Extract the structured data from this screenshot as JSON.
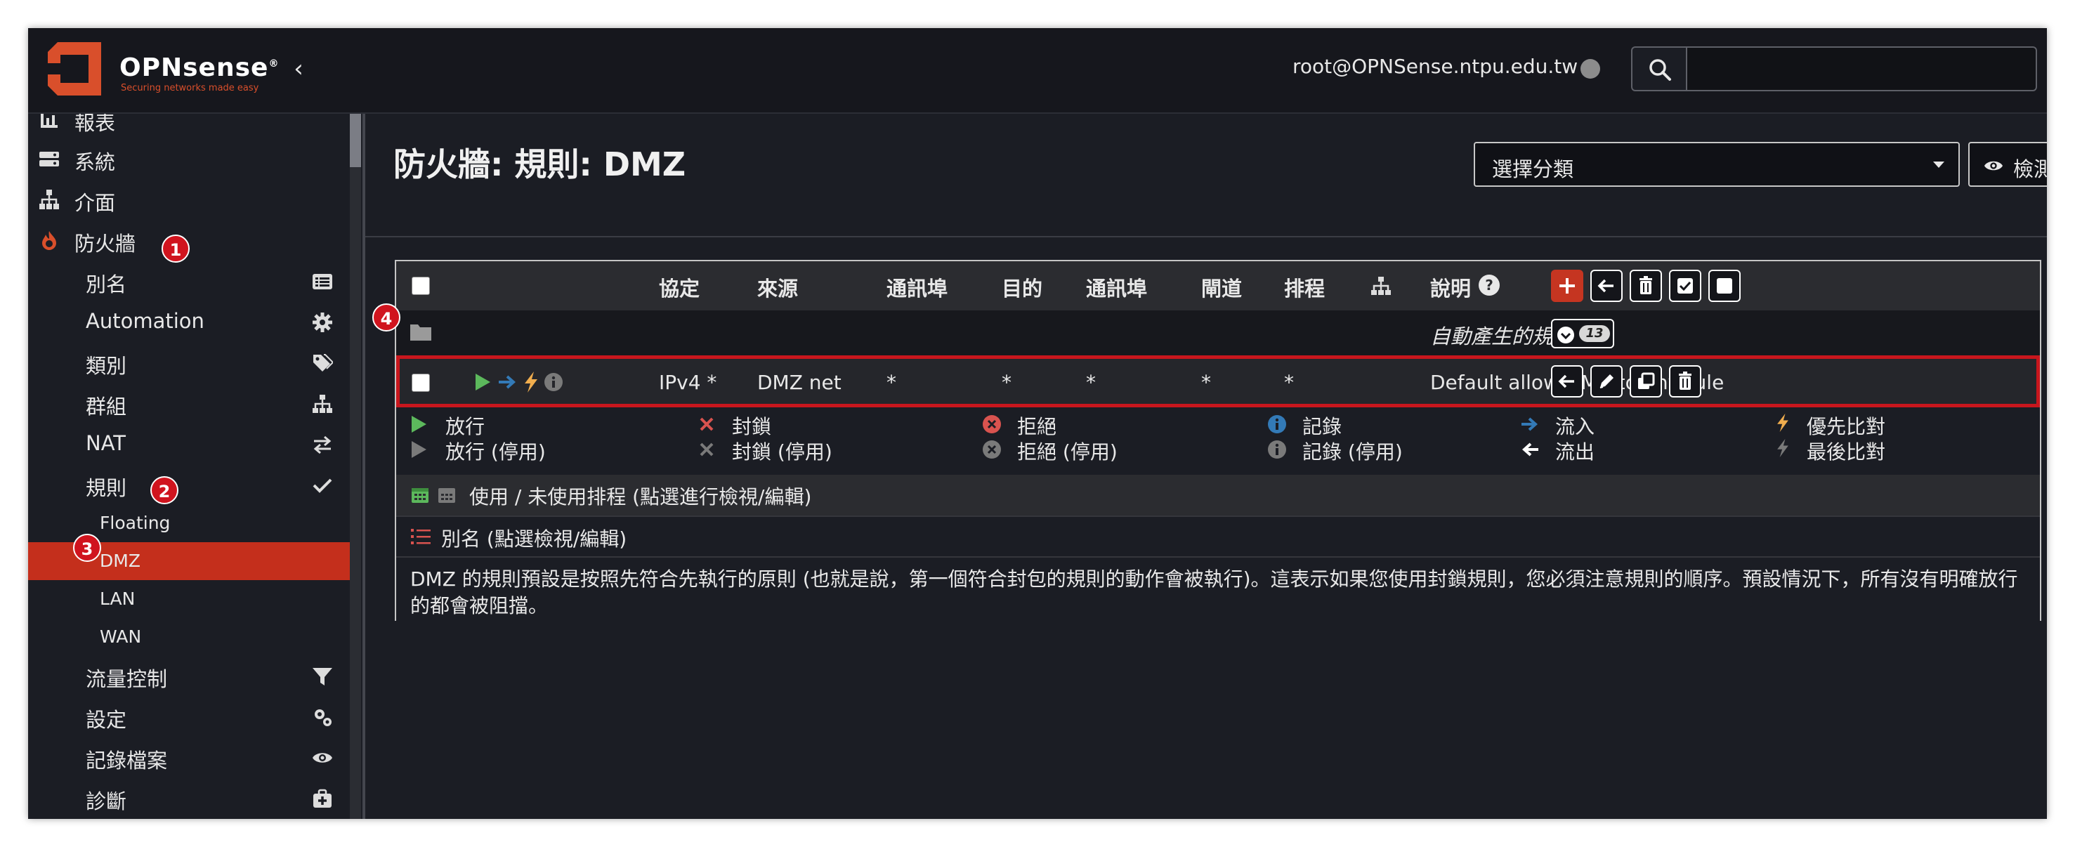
{
  "header": {
    "brand": "OPNsense",
    "brand_mark": "®",
    "tagline": "Securing networks made easy",
    "user": "root@OPNSense.ntpu.edu.tw"
  },
  "sidebar": {
    "items": [
      {
        "label": "報表",
        "icon": "reports-icon"
      },
      {
        "label": "系統",
        "icon": "system-icon"
      },
      {
        "label": "介面",
        "icon": "interfaces-icon"
      },
      {
        "label": "防火牆",
        "icon": "fire-icon"
      },
      {
        "label": "別名",
        "icon": "list-icon"
      },
      {
        "label": "Automation",
        "icon": "gear-icon"
      },
      {
        "label": "類別",
        "icon": "tags-icon"
      },
      {
        "label": "群組",
        "icon": "sitemap-icon"
      },
      {
        "label": "NAT",
        "icon": "exchange-icon"
      },
      {
        "label": "規則",
        "icon": "check-icon"
      },
      {
        "label": "Floating"
      },
      {
        "label": "DMZ"
      },
      {
        "label": "LAN"
      },
      {
        "label": "WAN"
      },
      {
        "label": "流量控制",
        "icon": "filter-icon"
      },
      {
        "label": "設定",
        "icon": "cogs-icon"
      },
      {
        "label": "記錄檔案",
        "icon": "eye-icon"
      },
      {
        "label": "診斷",
        "icon": "medkit-icon"
      }
    ]
  },
  "main": {
    "title": "防火牆: 規則: DMZ",
    "category_select": "選擇分類",
    "inspect_label": "檢測",
    "columns": [
      "協定",
      "來源",
      "通訊埠",
      "目的",
      "通訊埠",
      "閘道",
      "排程",
      "說明"
    ],
    "auto_rules_label": "自動產生的規則",
    "auto_rules_count": "13",
    "rule": {
      "protocol": "IPv4 *",
      "source": "DMZ net",
      "src_port": "*",
      "destination": "*",
      "dst_port": "*",
      "gateway": "*",
      "schedule": "*",
      "description": "Default allow DMZ to any rule"
    },
    "legend": [
      {
        "label": "放行",
        "icon": "pass-icon",
        "color": "#5cb85c"
      },
      {
        "label": "封鎖",
        "icon": "block-icon",
        "color": "#d9534f"
      },
      {
        "label": "拒絕",
        "icon": "reject-icon",
        "color": "#d9534f"
      },
      {
        "label": "記錄",
        "icon": "log-icon",
        "color": "#337ab7"
      },
      {
        "label": "流入",
        "icon": "in-icon",
        "color": "#337ab7"
      },
      {
        "label": "優先比對",
        "icon": "quick-icon",
        "color": "#f0ad4e"
      },
      {
        "label": "放行 (停用)",
        "icon": "pass-disabled-icon"
      },
      {
        "label": "封鎖 (停用)",
        "icon": "block-disabled-icon"
      },
      {
        "label": "拒絕 (停用)",
        "icon": "reject-disabled-icon"
      },
      {
        "label": "記錄 (停用)",
        "icon": "log-disabled-icon"
      },
      {
        "label": "流出",
        "icon": "out-icon"
      },
      {
        "label": "最後比對",
        "icon": "last-icon"
      }
    ],
    "schedule_note": "使用 / 未使用排程 (點選進行檢視/編輯)",
    "alias_note": "別名 (點選檢視/編輯)",
    "description_note": "DMZ 的規則預設是按照先符合先執行的原則 (也就是說，第一個符合封包的規則的動作會被執行)。這表示如果您使用封鎖規則，您必須注意規則的順序。預設情況下，所有沒有明確放行的都會被阻擋。"
  },
  "annotations": [
    "1",
    "2",
    "3",
    "4"
  ],
  "colors": {
    "accent": "#c42f1c",
    "highlight": "#c8161d",
    "background": "#1b1d24"
  }
}
